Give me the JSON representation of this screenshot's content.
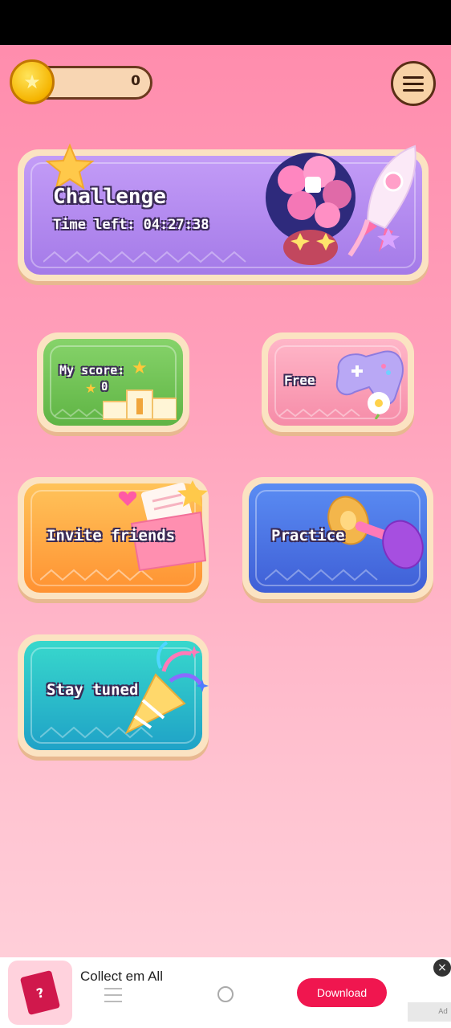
{
  "header": {
    "coin_count": "0",
    "coin_icon": "star-coin",
    "menu_icon": "hamburger-menu"
  },
  "cards": {
    "challenge": {
      "title": "Challenge",
      "time_left": "Time left: 04:27:38"
    },
    "my_score": {
      "title": "My score:",
      "value": "0"
    },
    "free": {
      "title": "Free"
    },
    "invite": {
      "title": "Invite friends"
    },
    "practice": {
      "title": "Practice"
    },
    "stay_tuned": {
      "title": "Stay tuned"
    }
  },
  "ad": {
    "title": "Collect em All",
    "download_label": "Download",
    "close_label": "×",
    "icon_glyph": "?",
    "badge": "Ad"
  },
  "colors": {
    "challenge": "#a47ae8",
    "my_score": "#6fc24f",
    "free": "#f68ca8",
    "invite": "#ff9a3c",
    "practice": "#4568dc",
    "stay_tuned": "#25b7c9",
    "download": "#f0164f"
  }
}
